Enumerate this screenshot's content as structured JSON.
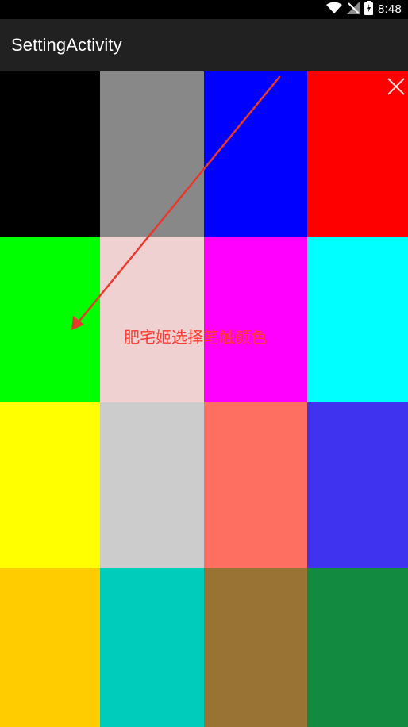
{
  "status_bar": {
    "time": "8:48",
    "icons": [
      "wifi-icon",
      "signal-icon",
      "battery-icon"
    ]
  },
  "app_bar": {
    "title": "SettingActivity"
  },
  "close_button": {
    "icon": "close-icon"
  },
  "annotation": {
    "text": "肥宅姬选择笔触颜色",
    "color": "#ff3b30"
  },
  "color_palette": {
    "columns": 4,
    "rows": 4,
    "swatches": [
      "#000000",
      "#888888",
      "#0000ff",
      "#ff0000",
      "#00ff00",
      "#efd1d1",
      "#ff00ff",
      "#00ffff",
      "#ffff00",
      "#cccccc",
      "#ff6f61",
      "#3f33f0",
      "#ffcc00",
      "#00ccbc",
      "#987334",
      "#128a3f"
    ]
  }
}
